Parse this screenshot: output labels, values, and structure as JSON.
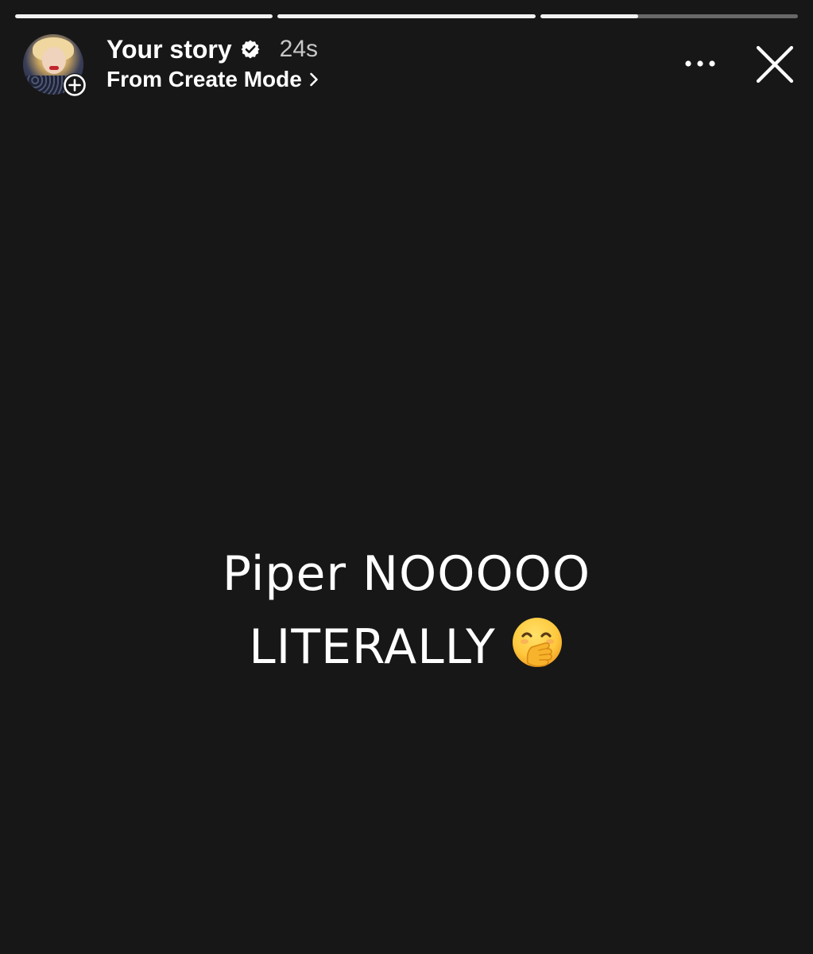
{
  "progress": {
    "segments": [
      {
        "fill": 1.0
      },
      {
        "fill": 1.0
      },
      {
        "fill": 0.38
      }
    ]
  },
  "header": {
    "title": "Your story",
    "time_ago": "24s",
    "subtitle": "From Create Mode",
    "icons": {
      "verified": "verified-badge-icon",
      "add": "add-circle-icon",
      "chevron": "chevron-right-icon",
      "more": "more-horizontal-icon",
      "close": "close-icon"
    }
  },
  "story": {
    "line1": "Piper NOOOOO",
    "line2": "LITERALLY",
    "emoji": "face-with-hand-over-mouth-emoji"
  },
  "colors": {
    "background": "#171717",
    "text": "#ffffff",
    "muted": "#c8c8c8",
    "emoji_yellow": "#ffc83d"
  }
}
